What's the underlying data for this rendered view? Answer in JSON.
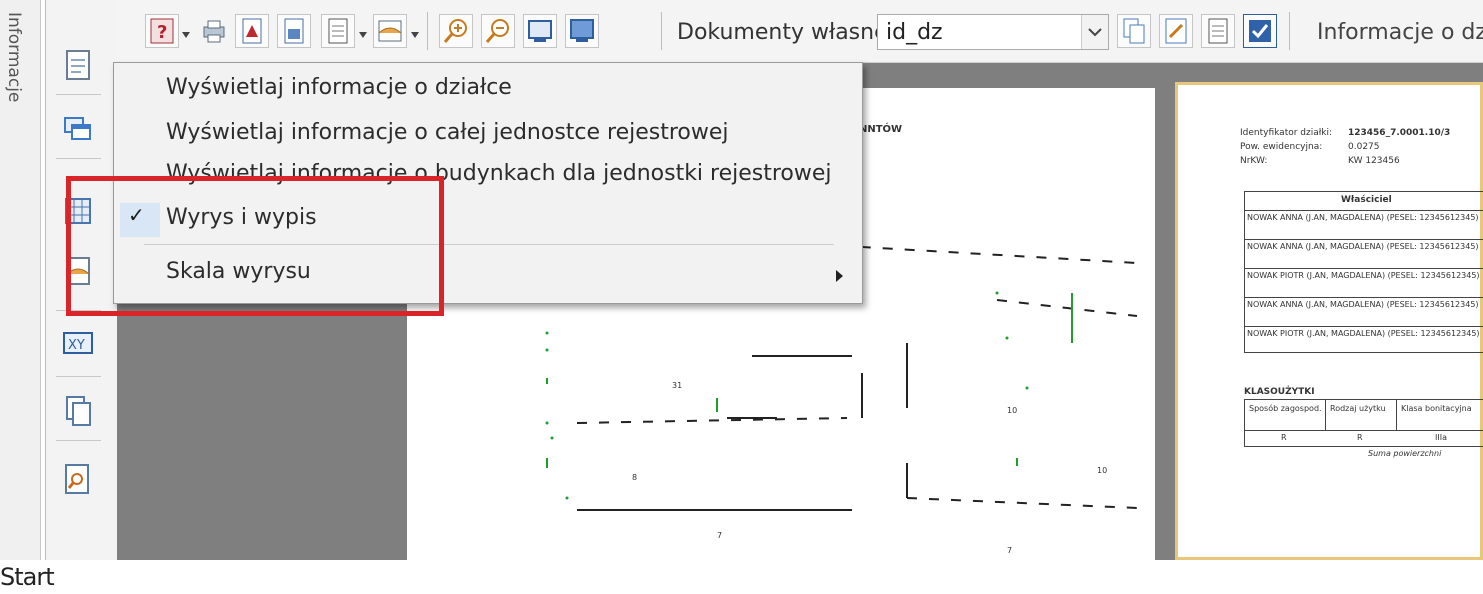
{
  "side_tab": {
    "label": "Informacje"
  },
  "toolbar": {
    "dokumenty_label": "Dokumenty własne:",
    "dokumenty_value": "id_dz",
    "info_label": "Informacje o dz"
  },
  "menu": {
    "items": [
      {
        "label": "Wyświetlaj informacje o działce"
      },
      {
        "label": "Wyświetlaj informacje o całej jednostce rejestrowej"
      },
      {
        "label": "Wyświetlaj informacje o budynkach dla jednostki rejestrowej"
      },
      {
        "label": "Wyrys i wypis",
        "checked": true
      },
      {
        "label": "Skala wyrysu",
        "submenu": true
      }
    ],
    "check_glyph": "✓"
  },
  "document": {
    "header_fragment": "NNTÓW",
    "info": {
      "identyfikator_label": "Identyfikator działki:",
      "identyfikator_value": "123456_7.0001.10/3",
      "pow_label": "Pow. ewidencyjna:",
      "pow_value": "0.0275",
      "nkw_label": "NrKW:",
      "nkw_value": "KW 123456"
    },
    "owners_header": "Właściciel",
    "owners": [
      "NOWAK ANNA (J.AN, MAGDALENA) (PESEL: 12345612345)",
      "NOWAK ANNA (J.AN, MAGDALENA) (PESEL: 12345612345)",
      "NOWAK PIOTR (J.AN, MAGDALENA) (PESEL: 12345612345)",
      "NOWAK ANNA (J.AN, MAGDALENA) (PESEL: 12345612345)",
      "NOWAK PIOTR (J.AN, MAGDALENA) (PESEL: 12345612345)"
    ],
    "klasouzytki_title": "KLASOUŻYTKI",
    "klasouzytki_cols": [
      "Sposób zagospod.",
      "Rodzaj użytku",
      "Klasa bonitacyjna"
    ],
    "klasouzytki_row": [
      "R",
      "R",
      "IIIa"
    ],
    "klasouzytki_footer": "Suma powierzchni"
  },
  "status": {
    "text": "Start"
  },
  "colors": {
    "highlight": "#d9242a",
    "workspace": "#7f7f7f",
    "page_border": "#e8c77a"
  }
}
